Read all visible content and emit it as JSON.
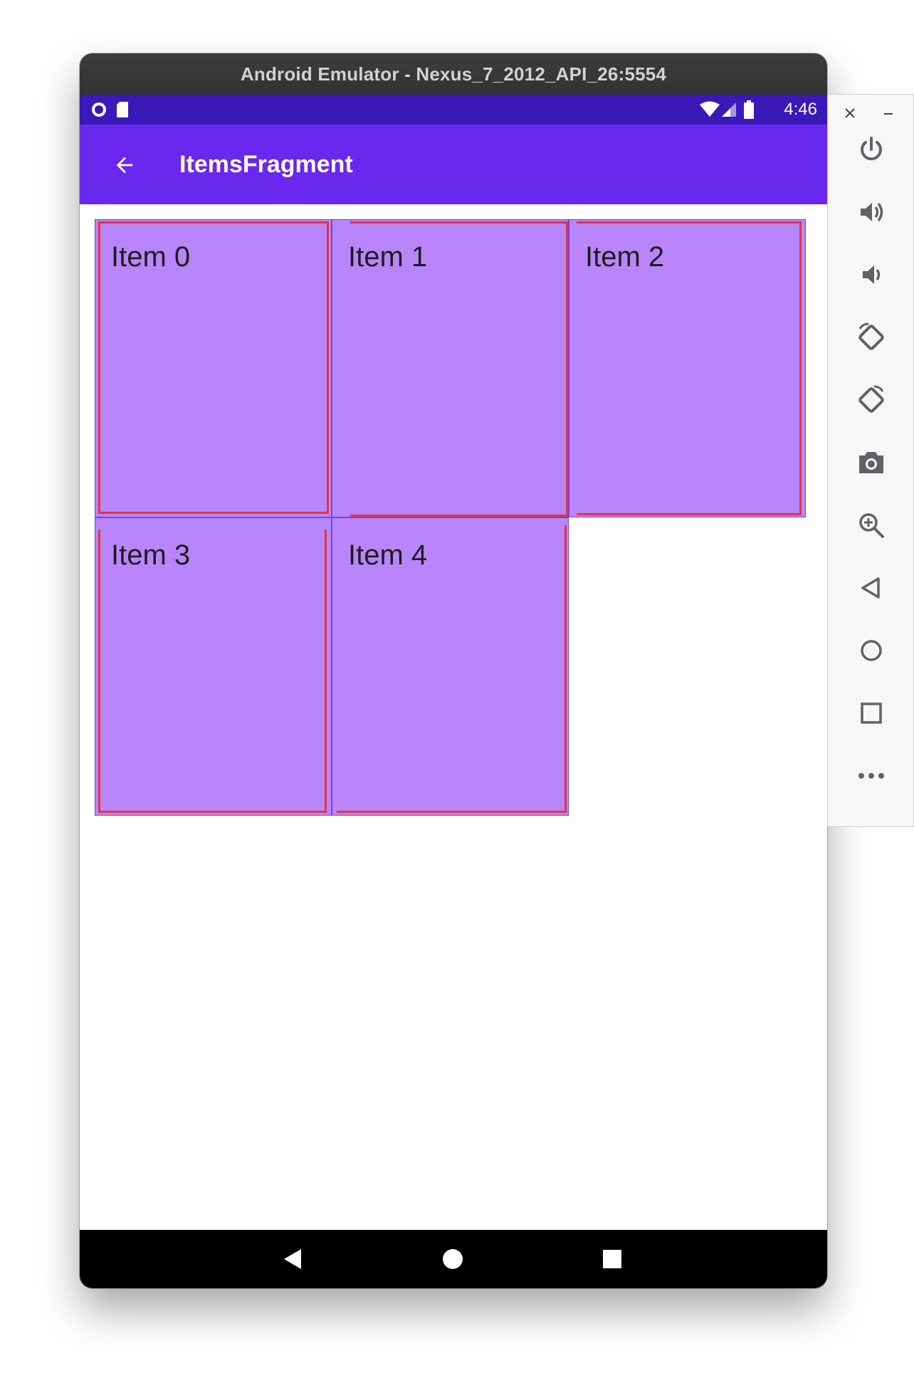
{
  "window": {
    "title": "Android Emulator - Nexus_7_2012_API_26:5554"
  },
  "status_bar": {
    "time": "4:46",
    "left_icons": [
      "record-circle-icon",
      "sd-card-icon"
    ],
    "right_icons": [
      "wifi-icon",
      "cell-signal-icon",
      "battery-icon"
    ]
  },
  "app_bar": {
    "title": "ItemsFragment",
    "back_icon": "arrow-back-icon"
  },
  "items": [
    {
      "label": "Item 0"
    },
    {
      "label": "Item 1"
    },
    {
      "label": "Item 2"
    },
    {
      "label": "Item 3"
    },
    {
      "label": "Item 4"
    }
  ],
  "nav_bar": {
    "buttons": [
      "back-triangle-icon",
      "home-circle-icon",
      "recents-square-icon"
    ]
  },
  "side_panel": {
    "top_controls": [
      "close-icon",
      "minimize-icon"
    ],
    "buttons": [
      "power-icon",
      "volume-up-icon",
      "volume-down-icon",
      "rotate-left-icon",
      "rotate-right-icon",
      "camera-icon",
      "zoom-icon",
      "back-icon",
      "home-icon",
      "overview-icon",
      "more-icon"
    ]
  },
  "colors": {
    "status_bar": "#3a19b8",
    "app_bar": "#6a27ee",
    "tile_fill": "#b985fb",
    "tile_border": "#6b45e6",
    "debug_outline": "#e8343c"
  }
}
